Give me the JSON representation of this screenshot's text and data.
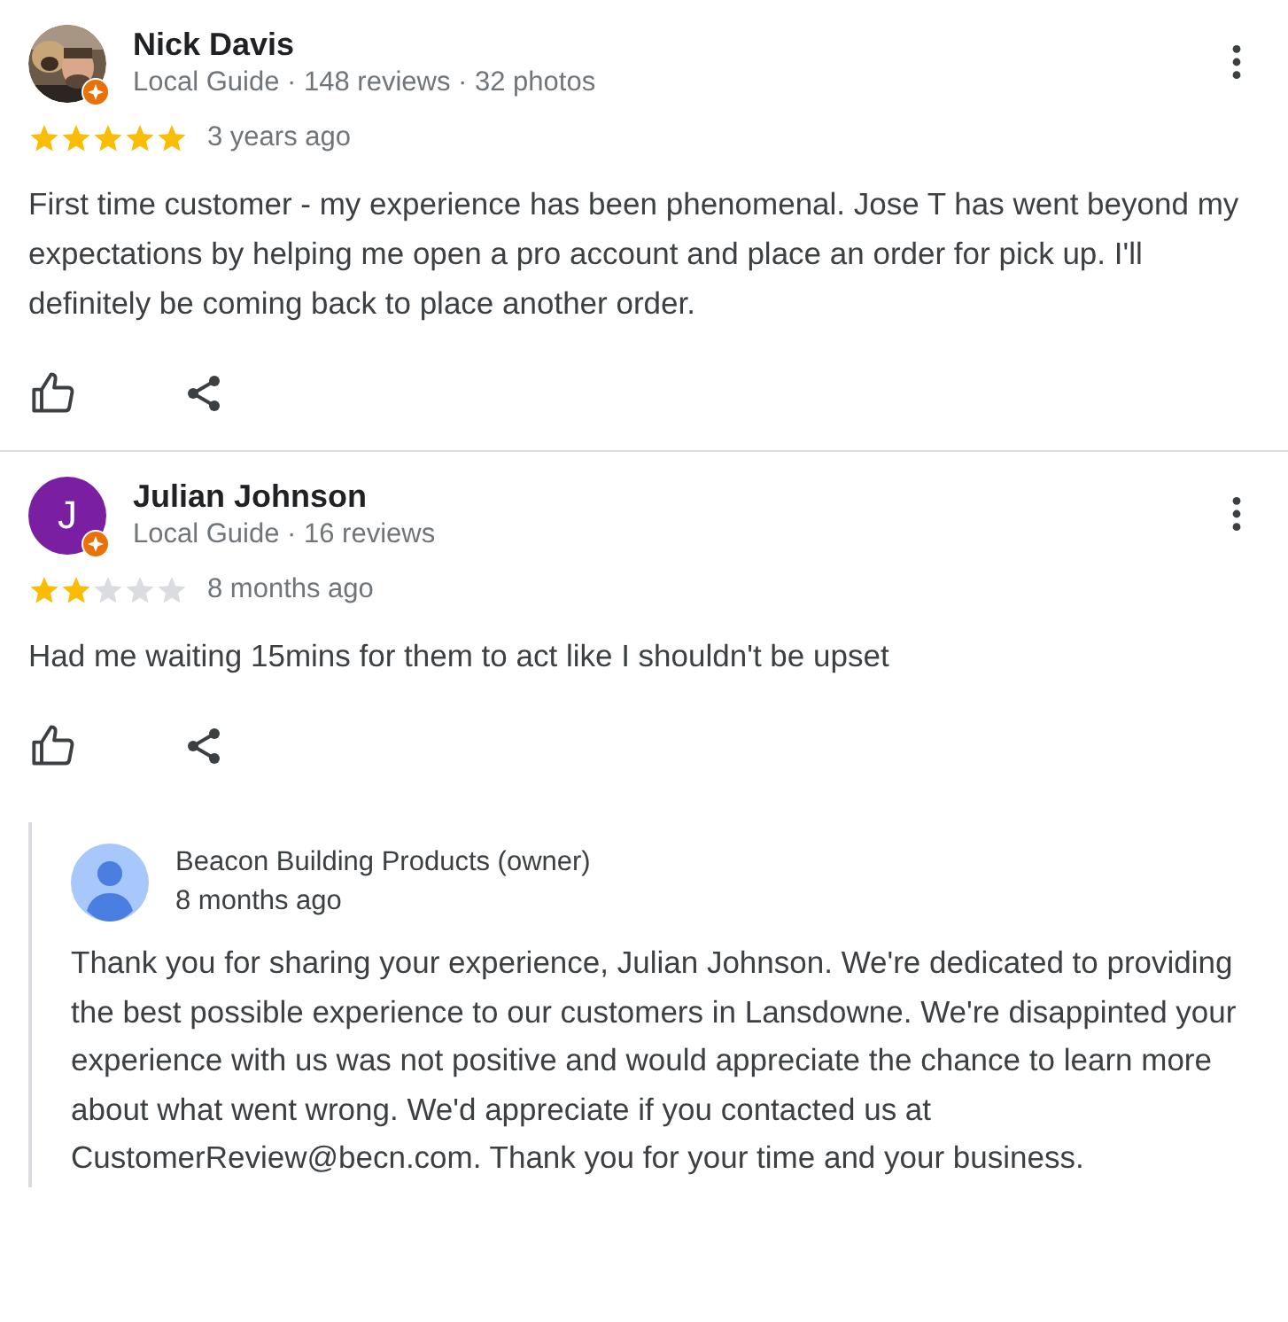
{
  "reviews": [
    {
      "author": "Nick Davis",
      "subtitle": "Local Guide · 148 reviews · 32 photos",
      "local_guide": true,
      "stars": 5,
      "time": "3 years ago",
      "text": "First time customer - my experience has been phenomenal. Jose T has went beyond my expectations by helping me open a pro account and place an order for pick up. I'll definitely be coming back to place another order."
    },
    {
      "author": "Julian Johnson",
      "avatar": {
        "kind": "initial",
        "letter": "J",
        "color": "#7b1fa2"
      },
      "subtitle": "Local Guide · 16 reviews",
      "local_guide": true,
      "stars": 2,
      "time": "8 months ago",
      "text": "Had me waiting 15mins for them to act like I shouldn't be upset",
      "reply": {
        "author": "Beacon Building Products (owner)",
        "time": "8 months ago",
        "text": "Thank you for sharing your experience, Julian Johnson. We're dedicated to providing the best possible experience to our customers in Lansdowne. We're disappinted your experience with us was not positive and would appreciate the chance to learn more about what went wrong. We'd appreciate if you contacted us at CustomerReview@becn.com. Thank you for your time and your business."
      }
    }
  ]
}
